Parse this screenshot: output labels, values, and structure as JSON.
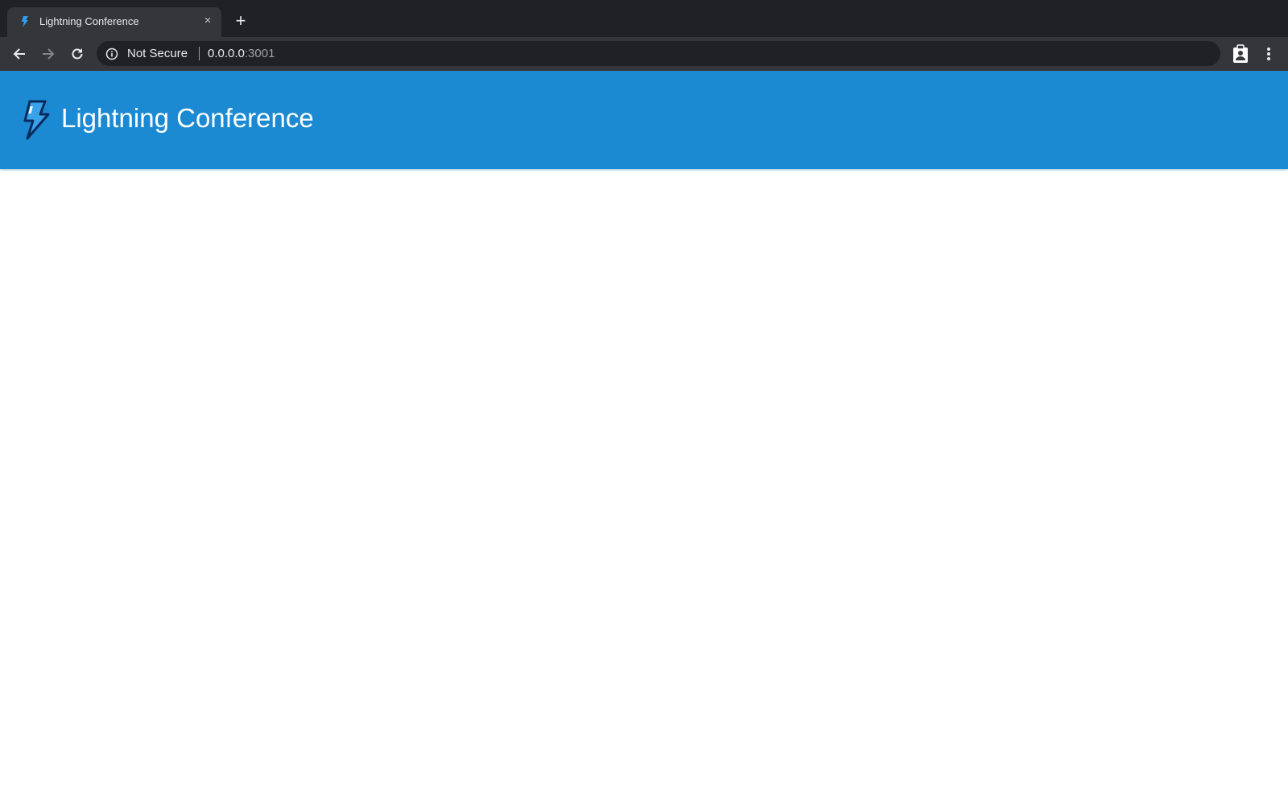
{
  "browser": {
    "tab": {
      "title": "Lightning Conference",
      "favicon": "lightning-bolt-icon",
      "close_label": "×"
    },
    "new_tab_label": "+",
    "nav": {
      "back": "arrow-left-icon",
      "forward": "arrow-right-icon",
      "reload": "reload-icon"
    },
    "omnibox": {
      "security_label": "Not Secure",
      "host": "0.0.0.0",
      "port": ":3001"
    },
    "extensions": [
      "clipboard-badge-icon"
    ],
    "menu": "kebab-menu-icon"
  },
  "app": {
    "title": "Lightning Conference",
    "logo": "lightning-bolt-icon",
    "colors": {
      "header": "#1b8ad2",
      "logo_outline": "#0b2a5c",
      "logo_fill": "#3aa2ea"
    }
  }
}
